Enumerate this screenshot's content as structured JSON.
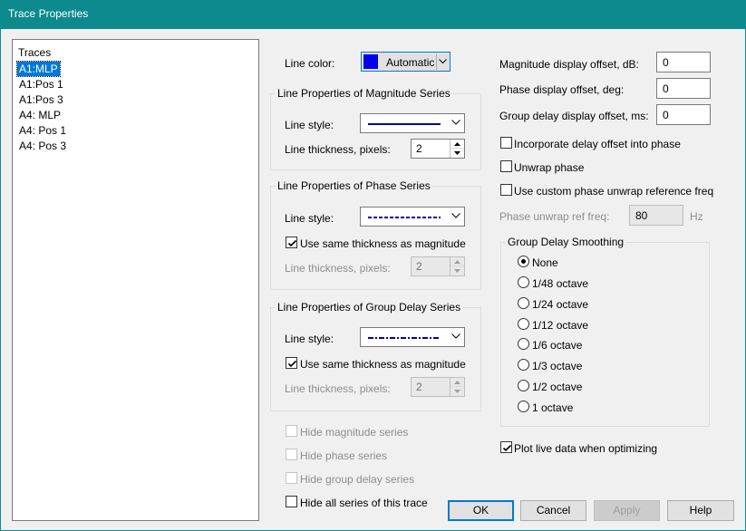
{
  "window": {
    "title": "Trace Properties"
  },
  "traces": {
    "header": "Traces",
    "items": [
      {
        "label": "A1:MLP",
        "selected": true
      },
      {
        "label": "A1:Pos 1",
        "selected": false
      },
      {
        "label": "A1:Pos 3",
        "selected": false
      },
      {
        "label": "A4: MLP",
        "selected": false
      },
      {
        "label": "A4: Pos 1",
        "selected": false
      },
      {
        "label": "A4: Pos 3",
        "selected": false
      }
    ]
  },
  "line_color": {
    "label": "Line color:",
    "value": "Automatic",
    "swatch_color": "#0000ee"
  },
  "magnitude": {
    "group_label": "Line Properties of Magnitude Series",
    "style_label": "Line style:",
    "style": "solid",
    "line_color": "#0000aa",
    "thickness_label": "Line thickness, pixels:",
    "thickness": "2"
  },
  "phase": {
    "group_label": "Line Properties of Phase Series",
    "style_label": "Line style:",
    "style": "dashed",
    "line_color": "#0000aa",
    "same_thickness_label": "Use same thickness as magnitude",
    "same_thickness_checked": true,
    "thickness_label": "Line thickness, pixels:",
    "thickness": "2"
  },
  "group_delay": {
    "group_label": "Line Properties of Group Delay Series",
    "style_label": "Line style:",
    "style": "dash-dot",
    "line_color": "#0000aa",
    "same_thickness_label": "Use same thickness as magnitude",
    "same_thickness_checked": true,
    "thickness_label": "Line thickness, pixels:",
    "thickness": "2"
  },
  "hide_options": {
    "hide_magnitude": {
      "label": "Hide magnitude series",
      "checked": false,
      "enabled": false
    },
    "hide_phase": {
      "label": "Hide phase series",
      "checked": false,
      "enabled": false
    },
    "hide_group_delay": {
      "label": "Hide group delay series",
      "checked": false,
      "enabled": false
    },
    "hide_all": {
      "label": "Hide all series of this trace",
      "checked": false,
      "enabled": true
    }
  },
  "offsets": {
    "magnitude": {
      "label": "Magnitude display offset, dB:",
      "value": "0"
    },
    "phase": {
      "label": "Phase display offset, deg:",
      "value": "0"
    },
    "group_delay": {
      "label": "Group delay display offset, ms:",
      "value": "0"
    }
  },
  "phase_options": {
    "incorporate_delay": {
      "label": "Incorporate delay offset into phase",
      "checked": false
    },
    "unwrap_phase": {
      "label": "Unwrap phase",
      "checked": false
    },
    "custom_unwrap": {
      "label": "Use custom phase unwrap reference freq",
      "checked": false
    },
    "unwrap_ref": {
      "label": "Phase unwrap ref freq:",
      "value": "80",
      "unit": "Hz"
    }
  },
  "smoothing": {
    "group_label": "Group Delay Smoothing",
    "options": [
      {
        "label": "None",
        "selected": true
      },
      {
        "label": "1/48 octave",
        "selected": false
      },
      {
        "label": "1/24 octave",
        "selected": false
      },
      {
        "label": "1/12 octave",
        "selected": false
      },
      {
        "label": "1/6 octave",
        "selected": false
      },
      {
        "label": "1/3 octave",
        "selected": false
      },
      {
        "label": "1/2 octave",
        "selected": false
      },
      {
        "label": "1 octave",
        "selected": false
      }
    ]
  },
  "plot_live": {
    "label": "Plot live data when optimizing",
    "checked": true
  },
  "buttons": {
    "ok": "OK",
    "cancel": "Cancel",
    "apply": "Apply",
    "help": "Help"
  }
}
